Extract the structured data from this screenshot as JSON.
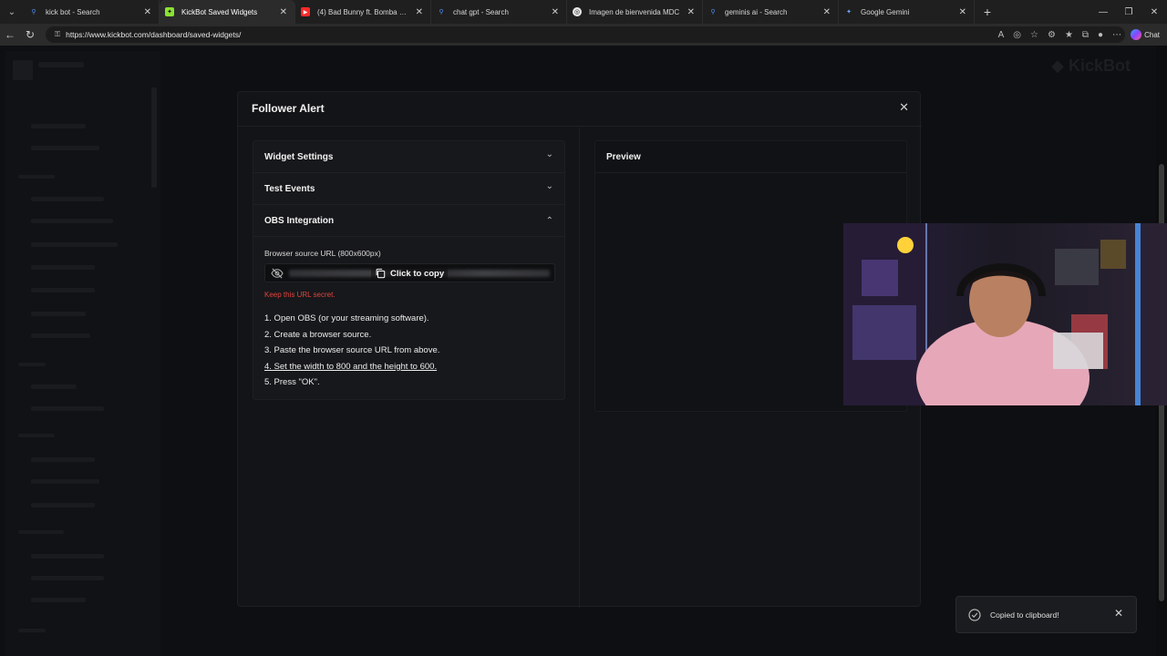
{
  "browser": {
    "tabs": [
      {
        "title": "kick bot - Search",
        "favicon": "search-icon",
        "color": "#4f8ef7",
        "active": false
      },
      {
        "title": "KickBot Saved Widgets",
        "favicon": "kickbot-icon",
        "color": "#8ae234",
        "active": true
      },
      {
        "title": "(4) Bad Bunny ft. Bomba Estéreo -",
        "favicon": "youtube-icon",
        "color": "#ff2a2a",
        "active": false
      },
      {
        "title": "chat gpt - Search",
        "favicon": "search-icon",
        "color": "#4f8ef7",
        "active": false
      },
      {
        "title": "Imagen de bienvenida MDC",
        "favicon": "chatgpt-icon",
        "color": "#e8e8e8",
        "active": false
      },
      {
        "title": "geminis ai - Search",
        "favicon": "search-icon",
        "color": "#4f8ef7",
        "active": false
      },
      {
        "title": "Google Gemini",
        "favicon": "gemini-icon",
        "color": "#6fa8ff",
        "active": false
      }
    ],
    "url": "https://www.kickbot.com/dashboard/saved-widgets/",
    "chat_label": "Chat"
  },
  "modal": {
    "title": "Follower Alert",
    "sections": {
      "widget_settings": "Widget Settings",
      "test_events": "Test Events",
      "obs_integration": "OBS Integration"
    },
    "obs": {
      "source_label": "Browser source URL (800x600px)",
      "copy_label": "Click to copy",
      "secret_note": "Keep this URL secret.",
      "steps": [
        "1. Open OBS (or your streaming software).",
        "2. Create a browser source.",
        "3. Paste the browser source URL from above.",
        "4. Set the width to 800 and the height to 600.",
        "5. Press \"OK\"."
      ]
    },
    "preview_title": "Preview"
  },
  "toast": {
    "message": "Copied to clipboard!"
  },
  "colors": {
    "secret_warning": "#e0443e",
    "panel_bg": "#17181b",
    "modal_bg": "#131417"
  }
}
